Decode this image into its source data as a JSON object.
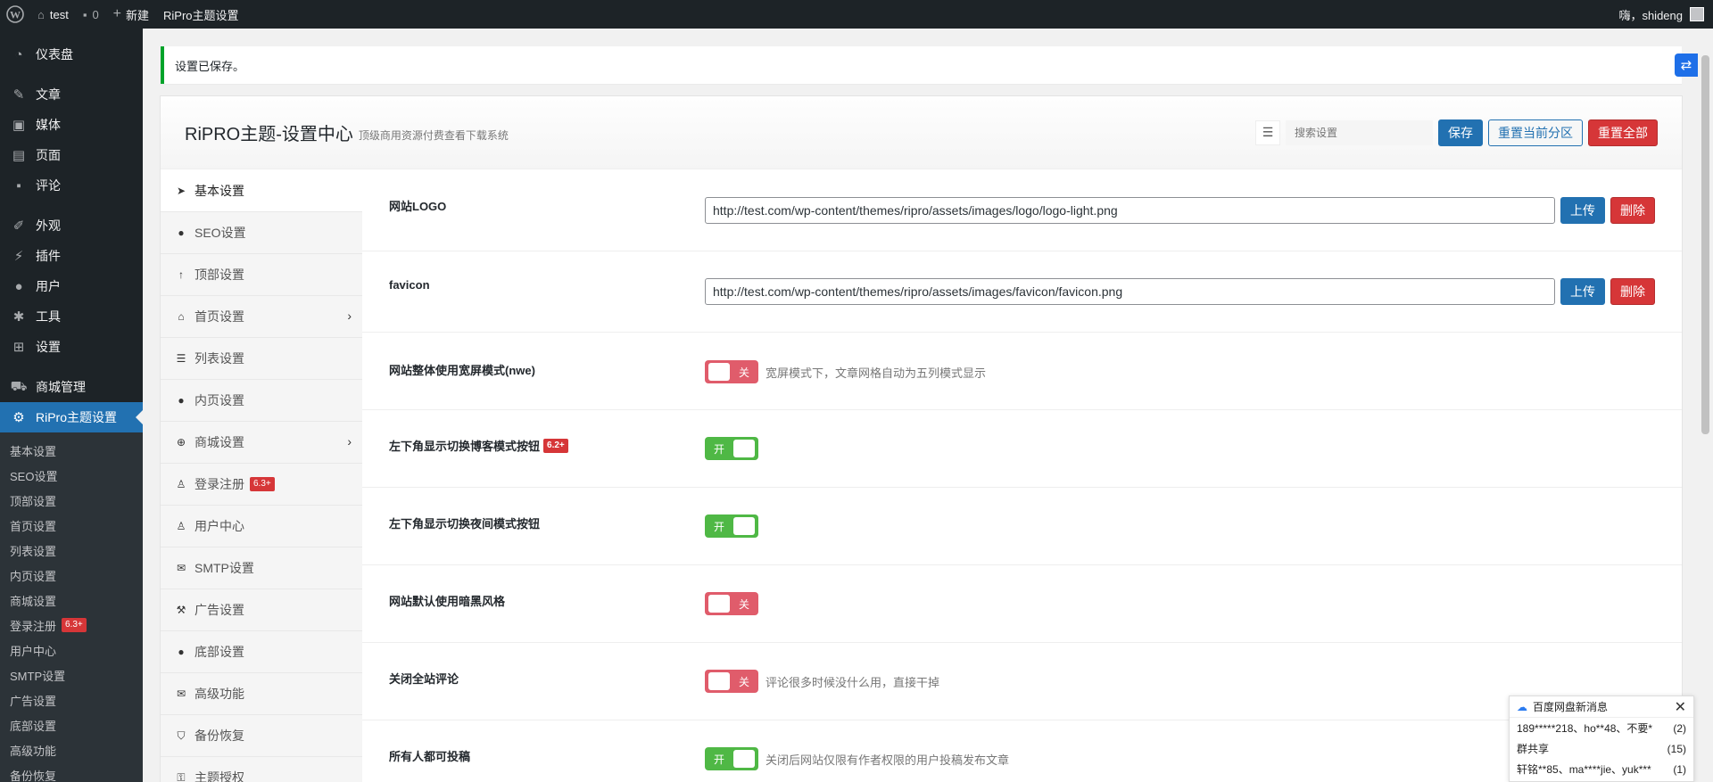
{
  "adminbar": {
    "site_name": "test",
    "comments_count": "0",
    "new_label": "新建",
    "theme_link": "RiPro主题设置",
    "greeting": "嗨，shideng"
  },
  "menu": {
    "items": [
      {
        "label": "仪表盘",
        "icon": "dashboard-icon"
      },
      {
        "label": "文章",
        "icon": "pin-icon"
      },
      {
        "label": "媒体",
        "icon": "media-icon"
      },
      {
        "label": "页面",
        "icon": "page-icon"
      },
      {
        "label": "评论",
        "icon": "comment-icon"
      },
      {
        "label": "外观",
        "icon": "brush-icon"
      },
      {
        "label": "插件",
        "icon": "plugin-icon"
      },
      {
        "label": "用户",
        "icon": "user-icon"
      },
      {
        "label": "工具",
        "icon": "wrench-icon"
      },
      {
        "label": "设置",
        "icon": "settings-icon"
      },
      {
        "label": "商城管理",
        "icon": "cart-icon"
      },
      {
        "label": "RiPro主题设置",
        "icon": "gear-icon"
      }
    ],
    "submenu": [
      "基本设置",
      "SEO设置",
      "顶部设置",
      "首页设置",
      "列表设置",
      "内页设置",
      "商城设置",
      "登录注册",
      "用户中心",
      "SMTP设置",
      "广告设置",
      "底部设置",
      "高级功能",
      "备份恢复"
    ],
    "login_badge": "6.3+"
  },
  "notice": "设置已保存。",
  "panel": {
    "title": "RiPRO主题-设置中心",
    "subtitle": "顶级商用资源付费查看下载系统",
    "search_placeholder": "搜索设置",
    "save": "保存",
    "reset_section": "重置当前分区",
    "reset_all": "重置全部"
  },
  "nav": [
    {
      "label": "基本设置",
      "icon": "rocket-icon"
    },
    {
      "label": "SEO设置",
      "icon": "circle-icon"
    },
    {
      "label": "顶部设置",
      "icon": "arrow-up-icon"
    },
    {
      "label": "首页设置",
      "icon": "home-icon"
    },
    {
      "label": "列表设置",
      "icon": "list-icon"
    },
    {
      "label": "内页设置",
      "icon": "circle-icon"
    },
    {
      "label": "商城设置",
      "icon": "plus-circle-icon"
    },
    {
      "label": "登录注册",
      "icon": "user-icon",
      "badge": "6.3+"
    },
    {
      "label": "用户中心",
      "icon": "user-icon"
    },
    {
      "label": "SMTP设置",
      "icon": "envelope-icon"
    },
    {
      "label": "广告设置",
      "icon": "gavel-icon"
    },
    {
      "label": "底部设置",
      "icon": "circle-icon"
    },
    {
      "label": "高级功能",
      "icon": "envelope-icon"
    },
    {
      "label": "备份恢复",
      "icon": "shield-icon"
    },
    {
      "label": "主题授权",
      "icon": "key-icon"
    }
  ],
  "fields": {
    "logo": {
      "label": "网站LOGO",
      "value": "http://test.com/wp-content/themes/ripro/assets/images/logo/logo-light.png",
      "upload": "上传",
      "delete": "删除"
    },
    "favicon": {
      "label": "favicon",
      "value": "http://test.com/wp-content/themes/ripro/assets/images/favicon/favicon.png",
      "upload": "上传",
      "delete": "删除"
    },
    "wide": {
      "label": "网站整体使用宽屏模式(nwe)",
      "state": "关",
      "desc": "宽屏模式下，文章网格自动为五列模式显示"
    },
    "blog_switch": {
      "label": "左下角显示切换博客模式按钮",
      "badge": "6.2+",
      "state": "开"
    },
    "night_switch": {
      "label": "左下角显示切换夜间模式按钮",
      "state": "开"
    },
    "dark": {
      "label": "网站默认使用暗黑风格",
      "state": "关"
    },
    "comments": {
      "label": "关闭全站评论",
      "state": "关",
      "desc": "评论很多时候没什么用，直接干掉"
    },
    "post": {
      "label": "所有人都可投稿",
      "state": "开",
      "desc": "关闭后网站仅限有作者权限的用户投稿发布文章"
    }
  },
  "baidu": {
    "title": "百度网盘新消息",
    "rows": [
      {
        "text": "189*****218、ho**48、不要*",
        "count": "(2)"
      },
      {
        "text": "群共享",
        "count": "(15)"
      },
      {
        "text": "轩铭**85、ma****jie、yuk***",
        "count": "(1)"
      }
    ]
  },
  "colors": {
    "accent": "#2271b1",
    "danger": "#d63638",
    "on": "#4fb845",
    "off": "#e05c6b",
    "menu_bg": "#1d2327"
  }
}
